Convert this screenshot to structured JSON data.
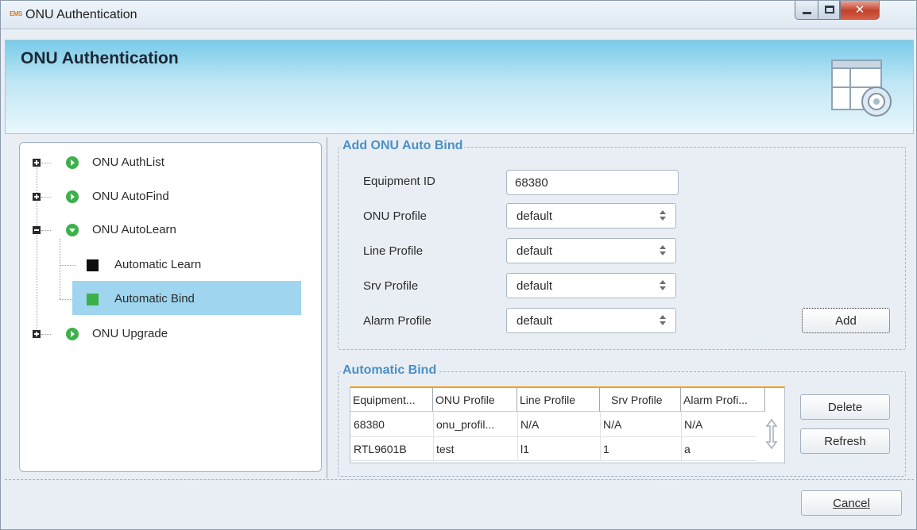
{
  "window": {
    "title": "ONU Authentication",
    "logo_text": "EMS"
  },
  "header": {
    "title": "ONU Authentication"
  },
  "tree": {
    "items": [
      {
        "label": "ONU AuthList"
      },
      {
        "label": "ONU AutoFind"
      },
      {
        "label": "ONU AutoLearn"
      },
      {
        "label": "Automatic Learn"
      },
      {
        "label": "Automatic Bind"
      },
      {
        "label": "ONU Upgrade"
      }
    ]
  },
  "add_bind": {
    "title": "Add ONU Auto Bind",
    "equipment_id_label": "Equipment ID",
    "equipment_id_value": "68380",
    "onu_profile_label": "ONU Profile",
    "onu_profile_value": "default",
    "line_profile_label": "Line Profile",
    "line_profile_value": "default",
    "srv_profile_label": "Srv Profile",
    "srv_profile_value": "default",
    "alarm_profile_label": "Alarm Profile",
    "alarm_profile_value": "default",
    "add_label": "Add"
  },
  "auto_bind": {
    "title": "Automatic Bind",
    "columns": [
      "Equipment...",
      "ONU Profile",
      "Line Profile",
      "Srv Profile",
      "Alarm Profi..."
    ],
    "rows": [
      [
        "68380",
        "onu_profil...",
        "N/A",
        "N/A",
        "N/A"
      ],
      [
        "RTL9601B",
        "test",
        "l1",
        "1",
        "a"
      ]
    ],
    "delete_label": "Delete",
    "refresh_label": "Refresh"
  },
  "footer": {
    "cancel_label": "Cancel"
  },
  "colors": {
    "accent": "#4a90c6",
    "selection": "#9fd5ee",
    "tree_icon": "#3cb04a",
    "table_accent": "#f4a11c"
  }
}
